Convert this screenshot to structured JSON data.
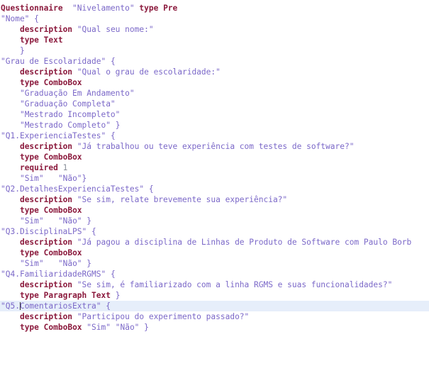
{
  "editor": {
    "background_color": "#ffffff",
    "current_line_highlight_color": "#e6eefa",
    "keyword_color": "#8b1a3d",
    "string_color": "#7b68c8",
    "number_color": "#8a8f9a",
    "caret_color": "#2b2b2b",
    "current_line_index": 24,
    "caret_line_text": "\"Q5.ComentariosExtra\" {",
    "caret_column": 4
  },
  "lines": [
    {
      "indent": 0,
      "tokens": [
        {
          "t": "kw",
          "v": "Questionnaire"
        },
        {
          "t": "ws",
          "v": "  "
        },
        {
          "t": "str",
          "v": "\"Nivelamento\""
        },
        {
          "t": "ws",
          "v": " "
        },
        {
          "t": "kw",
          "v": "type"
        },
        {
          "t": "ws",
          "v": " "
        },
        {
          "t": "tv",
          "v": "Pre"
        }
      ]
    },
    {
      "indent": 0,
      "tokens": [
        {
          "t": "str",
          "v": "\"Nome\""
        },
        {
          "t": "ws",
          "v": " "
        },
        {
          "t": "punc",
          "v": "{"
        }
      ]
    },
    {
      "indent": 1,
      "tokens": [
        {
          "t": "kw",
          "v": "description"
        },
        {
          "t": "ws",
          "v": " "
        },
        {
          "t": "str",
          "v": "\"Qual seu nome:\""
        }
      ]
    },
    {
      "indent": 1,
      "tokens": [
        {
          "t": "kw",
          "v": "type"
        },
        {
          "t": "ws",
          "v": " "
        },
        {
          "t": "tv",
          "v": "Text"
        }
      ]
    },
    {
      "indent": 1,
      "tokens": [
        {
          "t": "punc",
          "v": "}"
        }
      ]
    },
    {
      "indent": 0,
      "tokens": [
        {
          "t": "str",
          "v": "\"Grau de Escolaridade\""
        },
        {
          "t": "ws",
          "v": " "
        },
        {
          "t": "punc",
          "v": "{"
        }
      ]
    },
    {
      "indent": 1,
      "tokens": [
        {
          "t": "kw",
          "v": "description"
        },
        {
          "t": "ws",
          "v": " "
        },
        {
          "t": "str",
          "v": "\"Qual o grau de escolaridade:\""
        }
      ]
    },
    {
      "indent": 1,
      "tokens": [
        {
          "t": "kw",
          "v": "type"
        },
        {
          "t": "ws",
          "v": " "
        },
        {
          "t": "tv",
          "v": "ComboBox"
        }
      ]
    },
    {
      "indent": 1,
      "tokens": [
        {
          "t": "str",
          "v": "\"Graduação Em Andamento\""
        }
      ]
    },
    {
      "indent": 1,
      "tokens": [
        {
          "t": "str",
          "v": "\"Graduação Completa\""
        }
      ]
    },
    {
      "indent": 1,
      "tokens": [
        {
          "t": "str",
          "v": "\"Mestrado Incompleto\""
        }
      ]
    },
    {
      "indent": 1,
      "tokens": [
        {
          "t": "str",
          "v": "\"Mestrado Completo\""
        },
        {
          "t": "ws",
          "v": " "
        },
        {
          "t": "punc",
          "v": "}"
        }
      ]
    },
    {
      "indent": 0,
      "tokens": [
        {
          "t": "str",
          "v": "\"Q1.ExperienciaTestes\""
        },
        {
          "t": "ws",
          "v": " "
        },
        {
          "t": "punc",
          "v": "{"
        }
      ]
    },
    {
      "indent": 1,
      "tokens": [
        {
          "t": "kw",
          "v": "description"
        },
        {
          "t": "ws",
          "v": " "
        },
        {
          "t": "str",
          "v": "\"Já trabalhou ou teve experiência com testes de software?\""
        }
      ]
    },
    {
      "indent": 1,
      "tokens": [
        {
          "t": "kw",
          "v": "type"
        },
        {
          "t": "ws",
          "v": " "
        },
        {
          "t": "tv",
          "v": "ComboBox"
        }
      ]
    },
    {
      "indent": 1,
      "tokens": [
        {
          "t": "kw",
          "v": "required"
        },
        {
          "t": "ws",
          "v": " "
        },
        {
          "t": "num",
          "v": "1"
        }
      ]
    },
    {
      "indent": 1,
      "tokens": [
        {
          "t": "str",
          "v": "\"Sim\""
        },
        {
          "t": "ws",
          "v": "   "
        },
        {
          "t": "str",
          "v": "\"Não\""
        },
        {
          "t": "punc",
          "v": "}"
        }
      ]
    },
    {
      "indent": 0,
      "tokens": [
        {
          "t": "str",
          "v": "\"Q2.DetalhesExperienciaTestes\""
        },
        {
          "t": "ws",
          "v": " "
        },
        {
          "t": "punc",
          "v": "{"
        }
      ]
    },
    {
      "indent": 1,
      "tokens": [
        {
          "t": "kw",
          "v": "description"
        },
        {
          "t": "ws",
          "v": " "
        },
        {
          "t": "str",
          "v": "\"Se sim, relate brevemente sua experiência?\""
        }
      ]
    },
    {
      "indent": 1,
      "tokens": [
        {
          "t": "kw",
          "v": "type"
        },
        {
          "t": "ws",
          "v": " "
        },
        {
          "t": "tv",
          "v": "ComboBox"
        }
      ]
    },
    {
      "indent": 1,
      "tokens": [
        {
          "t": "str",
          "v": "\"Sim\""
        },
        {
          "t": "ws",
          "v": "   "
        },
        {
          "t": "str",
          "v": "\"Não\""
        },
        {
          "t": "ws",
          "v": " "
        },
        {
          "t": "punc",
          "v": "}"
        }
      ]
    },
    {
      "indent": 0,
      "tokens": [
        {
          "t": "str",
          "v": "\"Q3.DisciplinaLPS\""
        },
        {
          "t": "ws",
          "v": " "
        },
        {
          "t": "punc",
          "v": "{"
        }
      ]
    },
    {
      "indent": 1,
      "clipped": true,
      "tokens": [
        {
          "t": "kw",
          "v": "description"
        },
        {
          "t": "ws",
          "v": " "
        },
        {
          "t": "str",
          "v": "\"Já pagou a disciplina de Linhas de Produto de Software com Paulo Borb"
        }
      ]
    },
    {
      "indent": 1,
      "tokens": [
        {
          "t": "kw",
          "v": "type"
        },
        {
          "t": "ws",
          "v": " "
        },
        {
          "t": "tv",
          "v": "ComboBox"
        }
      ]
    },
    {
      "indent": 1,
      "tokens": [
        {
          "t": "str",
          "v": "\"Sim\""
        },
        {
          "t": "ws",
          "v": "   "
        },
        {
          "t": "str",
          "v": "\"Não\""
        },
        {
          "t": "ws",
          "v": " "
        },
        {
          "t": "punc",
          "v": "}"
        }
      ]
    },
    {
      "indent": 0,
      "tokens": [
        {
          "t": "str",
          "v": "\"Q4.FamiliaridadeRGMS\""
        },
        {
          "t": "ws",
          "v": " "
        },
        {
          "t": "punc",
          "v": "{"
        }
      ]
    },
    {
      "indent": 1,
      "tokens": [
        {
          "t": "kw",
          "v": "description"
        },
        {
          "t": "ws",
          "v": " "
        },
        {
          "t": "str",
          "v": "\"Se sim, é familiarizado com a linha RGMS e suas funcionalidades?\""
        }
      ]
    },
    {
      "indent": 1,
      "tokens": [
        {
          "t": "kw",
          "v": "type"
        },
        {
          "t": "ws",
          "v": " "
        },
        {
          "t": "tv",
          "v": "Paragraph Text"
        },
        {
          "t": "ws",
          "v": " "
        },
        {
          "t": "punc",
          "v": "}"
        }
      ]
    },
    {
      "indent": 0,
      "current": true,
      "tokens": [
        {
          "t": "str",
          "v": "\"Q5."
        },
        {
          "t": "caret",
          "v": ""
        },
        {
          "t": "str",
          "v": "ComentariosExtra\""
        },
        {
          "t": "ws",
          "v": " "
        },
        {
          "t": "punc",
          "v": "{"
        }
      ]
    },
    {
      "indent": 1,
      "tokens": [
        {
          "t": "kw",
          "v": "description"
        },
        {
          "t": "ws",
          "v": " "
        },
        {
          "t": "str",
          "v": "\"Participou do experimento passado?\""
        }
      ]
    },
    {
      "indent": 1,
      "tokens": [
        {
          "t": "kw",
          "v": "type"
        },
        {
          "t": "ws",
          "v": " "
        },
        {
          "t": "tv",
          "v": "ComboBox"
        },
        {
          "t": "ws",
          "v": " "
        },
        {
          "t": "str",
          "v": "\"Sim\""
        },
        {
          "t": "ws",
          "v": " "
        },
        {
          "t": "str",
          "v": "\"Não\""
        },
        {
          "t": "ws",
          "v": " "
        },
        {
          "t": "punc",
          "v": "}"
        }
      ]
    }
  ]
}
